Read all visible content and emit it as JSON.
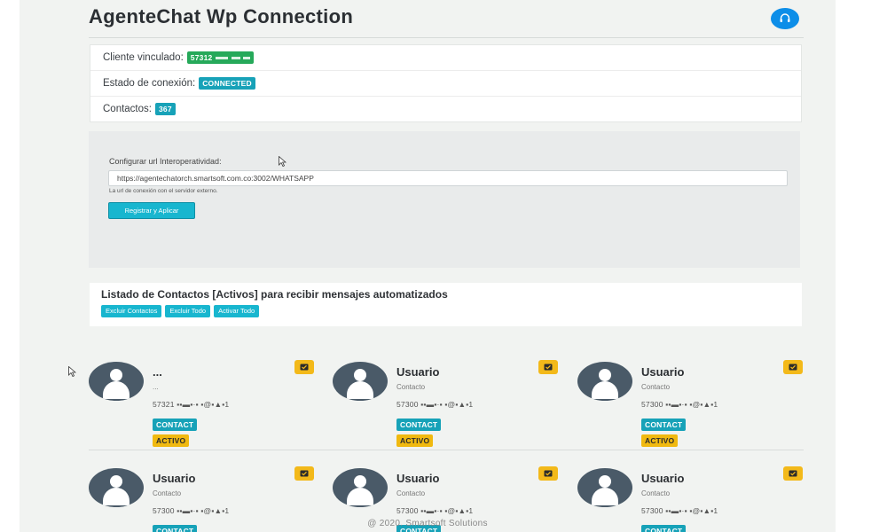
{
  "header": {
    "title": "AgenteChat Wp Connection",
    "support_icon": "headset-icon"
  },
  "info": {
    "client_label": "Cliente vinculado:",
    "client_value": "57312",
    "status_label": "Estado de conexión:",
    "status_value": "CONNECTED",
    "contacts_label": "Contactos:",
    "contacts_value": "367"
  },
  "config": {
    "label": "Configurar url Interoperatividad:",
    "url_value": "https://agentechatorch.smartsoft.com.co:3002/WHATSAPP",
    "help": "La url de conexión con el servidor externo.",
    "submit_label": "Registrar y Aplicar"
  },
  "list": {
    "title": "Listado de Contactos [Activos] para recibir mensajes automatizados",
    "buttons": [
      "Excluir Contactos",
      "Excluir Todo",
      "Activar Todo"
    ]
  },
  "contacts": [
    {
      "name": "...",
      "sub": "...",
      "phone": "57321",
      "badge1": "CONTACT",
      "badge2": "ACTIVO"
    },
    {
      "name": "Usuario",
      "sub": "Contacto",
      "phone": "57300",
      "badge1": "CONTACT",
      "badge2": "ACTIVO"
    },
    {
      "name": "Usuario",
      "sub": "Contacto",
      "phone": "57300",
      "badge1": "CONTACT",
      "badge2": "ACTIVO"
    },
    {
      "name": "Usuario",
      "sub": "Contacto",
      "phone": "57300",
      "badge1": "CONTACT",
      "badge2": ""
    },
    {
      "name": "Usuario",
      "sub": "Contacto",
      "phone": "57300",
      "badge1": "CONTACT",
      "badge2": ""
    },
    {
      "name": "Usuario",
      "sub": "Contacto",
      "phone": "57300",
      "badge1": "CONTACT",
      "badge2": ""
    }
  ],
  "footer": "@ 2020. Smartsoft Solutions",
  "colors": {
    "accent": "#18b6cf",
    "connected": "#17a2b8",
    "client_badge": "#26a95a",
    "active_badge": "#f0b910",
    "support_button": "#0d8ee8"
  }
}
